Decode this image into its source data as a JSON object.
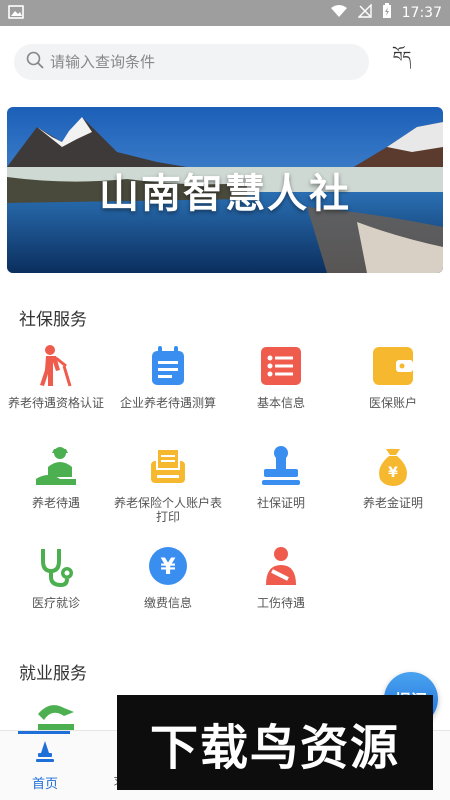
{
  "status_bar": {
    "time": "17:37"
  },
  "search": {
    "placeholder": "请输入查询条件",
    "value": ""
  },
  "header": {
    "lang_label": "བོད"
  },
  "banner": {
    "title": "山南智慧人社"
  },
  "social_section": {
    "title": "社保服务",
    "items": [
      {
        "label": "养老待遇资格认证",
        "icon": "elderly-person-icon"
      },
      {
        "label": "企业养老待遇测算",
        "icon": "calendar-list-icon"
      },
      {
        "label": "基本信息",
        "icon": "list-card-icon"
      },
      {
        "label": "医保账户",
        "icon": "wallet-icon"
      },
      {
        "label": "养老待遇",
        "icon": "elderly-hand-icon"
      },
      {
        "label": "养老保险个人账户表打印",
        "icon": "printer-icon"
      },
      {
        "label": "社保证明",
        "icon": "stamp-icon"
      },
      {
        "label": "养老金证明",
        "icon": "money-bag-icon"
      },
      {
        "label": "医疗就诊",
        "icon": "stethoscope-icon"
      },
      {
        "label": "缴费信息",
        "icon": "yuan-icon"
      },
      {
        "label": "工伤待遇",
        "icon": "injured-worker-icon"
      }
    ]
  },
  "employment_section": {
    "title": "就业服务"
  },
  "fab": {
    "label": "提问"
  },
  "tabs": [
    {
      "label": "首页",
      "active": true
    },
    {
      "label": "求"
    }
  ],
  "watermark": {
    "text": "下载鸟资源"
  },
  "colors": {
    "accent": "#1e6fd8",
    "orange": "#f5a623",
    "green": "#4caf50",
    "red": "#ef5b4c"
  }
}
